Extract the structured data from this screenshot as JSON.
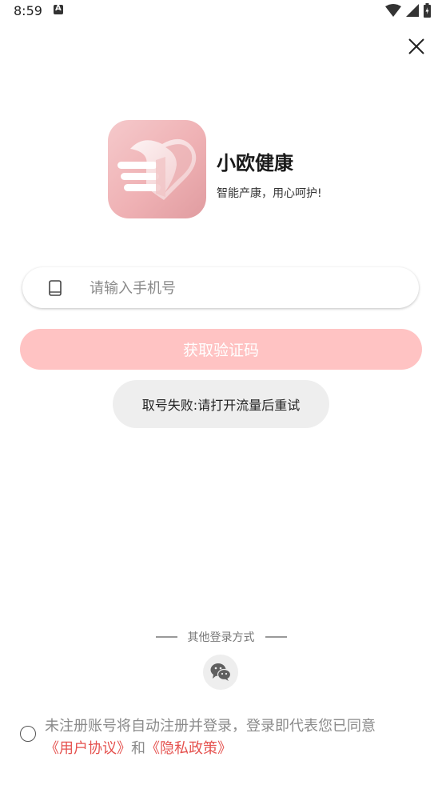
{
  "status_bar": {
    "time": "8:59"
  },
  "app": {
    "name": "小欧健康",
    "slogan": "智能产康，用心呵护!"
  },
  "login": {
    "phone_placeholder": "请输入手机号",
    "get_code_label": "获取验证码"
  },
  "toast": {
    "message": "取号失败:请打开流量后重试"
  },
  "other_login": {
    "label": "其他登录方式"
  },
  "agreement": {
    "text": "未注册账号将自动注册并登录，登录即代表您已同意",
    "user_agreement": "《用户协议》",
    "and": "和",
    "privacy_policy": "《隐私政策》"
  },
  "colors": {
    "button_bg": "#ffc3c3",
    "link": "#e5524f",
    "logo_pink": "#efb1b4"
  }
}
